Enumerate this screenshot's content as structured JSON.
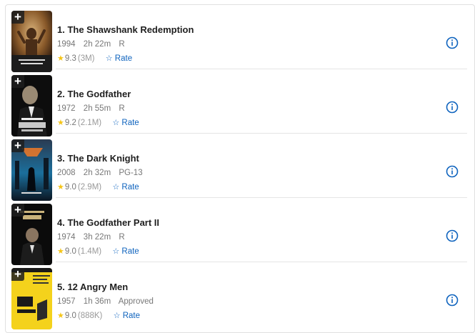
{
  "movies": [
    {
      "title": "1. The Shawshank Redemption",
      "year": "1994",
      "runtime": "2h 22m",
      "certificate": "R",
      "rating": "9.3",
      "votes": "(3M)",
      "rate_label": "Rate"
    },
    {
      "title": "2. The Godfather",
      "year": "1972",
      "runtime": "2h 55m",
      "certificate": "R",
      "rating": "9.2",
      "votes": "(2.1M)",
      "rate_label": "Rate"
    },
    {
      "title": "3. The Dark Knight",
      "year": "2008",
      "runtime": "2h 32m",
      "certificate": "PG-13",
      "rating": "9.0",
      "votes": "(2.9M)",
      "rate_label": "Rate"
    },
    {
      "title": "4. The Godfather Part II",
      "year": "1974",
      "runtime": "3h 22m",
      "certificate": "R",
      "rating": "9.0",
      "votes": "(1.4M)",
      "rate_label": "Rate"
    },
    {
      "title": "5. 12 Angry Men",
      "year": "1957",
      "runtime": "1h 36m",
      "certificate": "Approved",
      "rating": "9.0",
      "votes": "(888K)",
      "rate_label": "Rate"
    }
  ],
  "icons": {
    "add": "plus-icon",
    "star": "star-icon",
    "rate": "star-outline-icon",
    "info": "info-icon"
  },
  "colors": {
    "rating_star": "#f5c518",
    "link": "#0e63be"
  }
}
